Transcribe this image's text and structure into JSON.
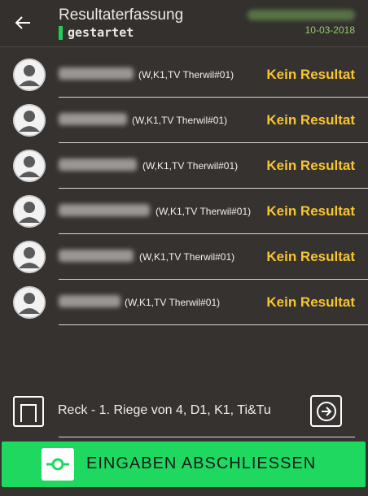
{
  "header": {
    "title": "Resultaterfassung",
    "status": "gestartet",
    "date": "10-03-2018"
  },
  "athletes": [
    {
      "club": "(W,K1,TV Therwil#01)",
      "result": "Kein Resultat"
    },
    {
      "club": "(W,K1,TV Therwil#01)",
      "result": "Kein Resultat"
    },
    {
      "club": "(W,K1,TV Therwil#01)",
      "result": "Kein Resultat"
    },
    {
      "club": "(W,K1,TV Therwil#01)",
      "result": "Kein Resultat"
    },
    {
      "club": "(W,K1,TV Therwil#01)",
      "result": "Kein Resultat"
    },
    {
      "club": "(W,K1,TV Therwil#01)",
      "result": "Kein Resultat"
    }
  ],
  "footer": {
    "apparatus": "Reck - 1. Riege von 4, D1, K1, Ti&Tu",
    "finish_label": "EINGABEN ABSCHLIESSEN"
  },
  "colors": {
    "background": "#363230",
    "accent_green": "#1ed85f",
    "result_yellow": "#f6c531"
  },
  "icons": {
    "back": "arrow-left-icon",
    "avatar": "person-avatar-icon",
    "apparatus": "apparatus-frame-icon",
    "next": "arrow-right-circle-icon",
    "finish": "check-switch-icon"
  }
}
